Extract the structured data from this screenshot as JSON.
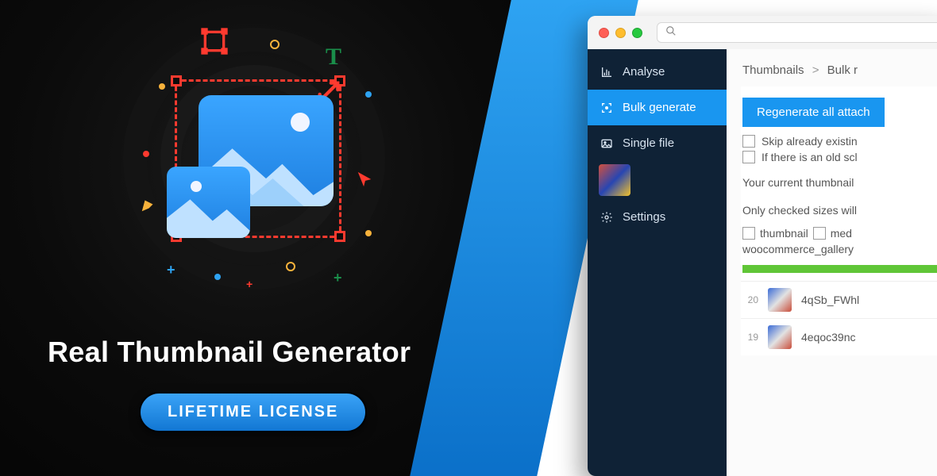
{
  "hero": {
    "title": "Real Thumbnail Generator",
    "license_button": "LIFETIME LICENSE"
  },
  "window": {
    "search_placeholder": ""
  },
  "sidebar": {
    "items": [
      {
        "label": "Analyse",
        "icon": "chart-icon"
      },
      {
        "label": "Bulk generate",
        "icon": "focus-icon",
        "active": true
      },
      {
        "label": "Single file",
        "icon": "image-icon"
      },
      {
        "label": "Settings",
        "icon": "gear-icon"
      }
    ]
  },
  "breadcrumb": {
    "root": "Thumbnails",
    "sep": ">",
    "current": "Bulk r"
  },
  "panel": {
    "primary_button": "Regenerate all attach",
    "check1": "Skip already existin",
    "check2": "If there is an old scl",
    "body1": "Your current thumbnail",
    "body2": "Only checked sizes will",
    "size1": "thumbnail",
    "size2": "med",
    "sizes_sub": "woocommerce_gallery",
    "rows": [
      {
        "num": "20",
        "name": "4qSb_FWhl"
      },
      {
        "num": "19",
        "name": "4eqoc39nc"
      }
    ]
  }
}
